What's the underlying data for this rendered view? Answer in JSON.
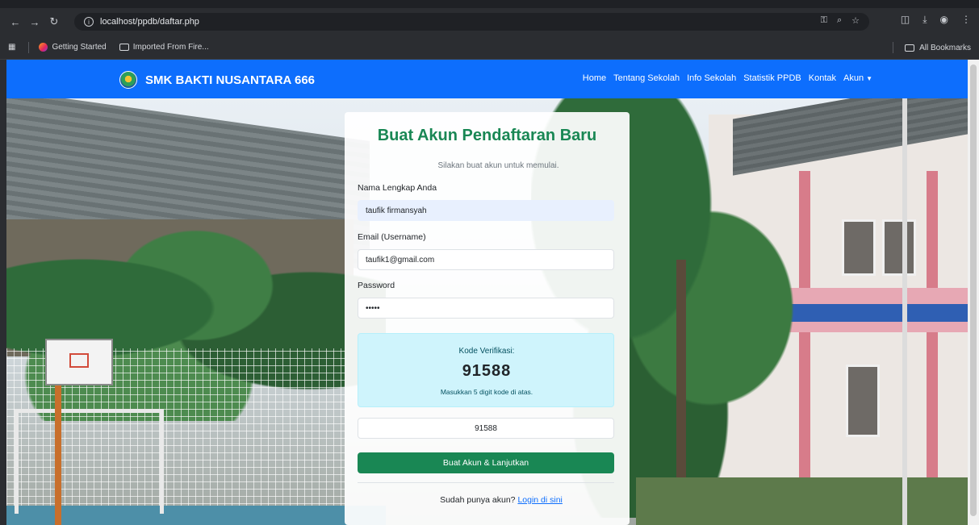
{
  "browser": {
    "url": "localhost/ppdb/daftar.php",
    "bookmarks": [
      "Getting Started",
      "Imported From Fire..."
    ],
    "all_bookmarks": "All Bookmarks"
  },
  "navbar": {
    "brand": "SMK BAKTI NUSANTARA 666",
    "links": [
      "Home",
      "Tentang Sekolah",
      "Info Sekolah",
      "Statistik PPDB",
      "Kontak",
      "Akun"
    ]
  },
  "form": {
    "title": "Buat Akun Pendaftaran Baru",
    "subtitle": "Silakan buat akun untuk memulai.",
    "name_label": "Nama Lengkap Anda",
    "name_value": "taufik firmansyah",
    "email_label": "Email (Username)",
    "email_value": "taufik1@gmail.com",
    "password_label": "Password",
    "password_value": "•••••",
    "verification": {
      "label": "Kode Verifikasi:",
      "code": "91588",
      "hint": "Masukkan 5 digit kode di atas."
    },
    "code_input_value": "91588",
    "submit_label": "Buat Akun & Lanjutkan",
    "login_prompt": "Sudah punya akun?",
    "login_link": "Login di sini"
  },
  "colors": {
    "navbar": "#0d6efd",
    "title_green": "#198754",
    "alert_info": "#cff4fc"
  }
}
